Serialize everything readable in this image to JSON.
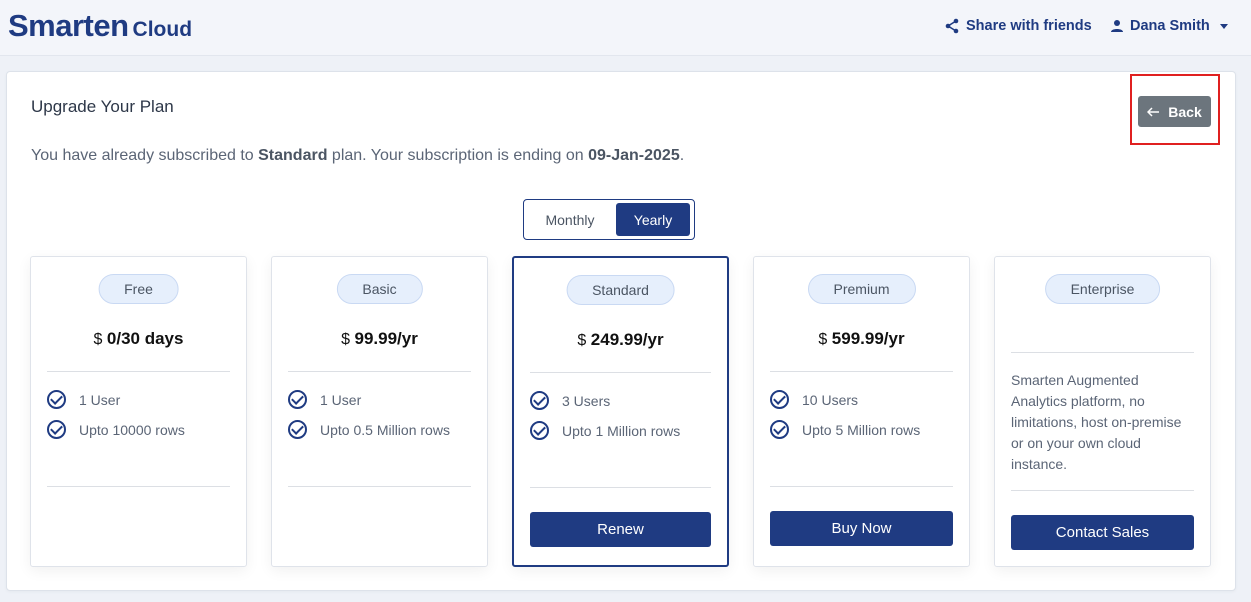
{
  "header": {
    "brand_main": "Smarten",
    "brand_sub": "Cloud",
    "share_label": "Share with friends",
    "user_name": "Dana Smith"
  },
  "panel": {
    "title": "Upgrade Your Plan",
    "sub_prefix": "You have already subscribed to ",
    "current_plan": "Standard",
    "sub_mid": " plan. Your subscription is ending on ",
    "end_date": "09-Jan-2025",
    "sub_suffix": ".",
    "back_label": "Back"
  },
  "billing_toggle": {
    "monthly": "Monthly",
    "yearly": "Yearly",
    "selected": "Yearly"
  },
  "plans": [
    {
      "name": "Free",
      "currency": "$",
      "amount": "0",
      "period": "/30 days",
      "features": [
        "1 User",
        "Upto 10000 rows"
      ],
      "action": ""
    },
    {
      "name": "Basic",
      "currency": "$",
      "amount": "99.99",
      "period": "/yr",
      "features": [
        "1 User",
        "Upto 0.5 Million rows"
      ],
      "action": ""
    },
    {
      "name": "Standard",
      "currency": "$",
      "amount": "249.99",
      "period": "/yr",
      "features": [
        "3 Users",
        "Upto 1 Million rows"
      ],
      "action": "Renew"
    },
    {
      "name": "Premium",
      "currency": "$",
      "amount": "599.99",
      "period": "/yr",
      "features": [
        "10 Users",
        "Upto 5 Million rows"
      ],
      "action": "Buy Now"
    },
    {
      "name": "Enterprise",
      "description": "Smarten Augmented Analytics platform, no limitations, host on-premise or on your own cloud instance.",
      "action": "Contact Sales"
    }
  ],
  "colors": {
    "brand": "#1f3b82",
    "back_button": "#6c757d",
    "highlight": "#e02020"
  }
}
